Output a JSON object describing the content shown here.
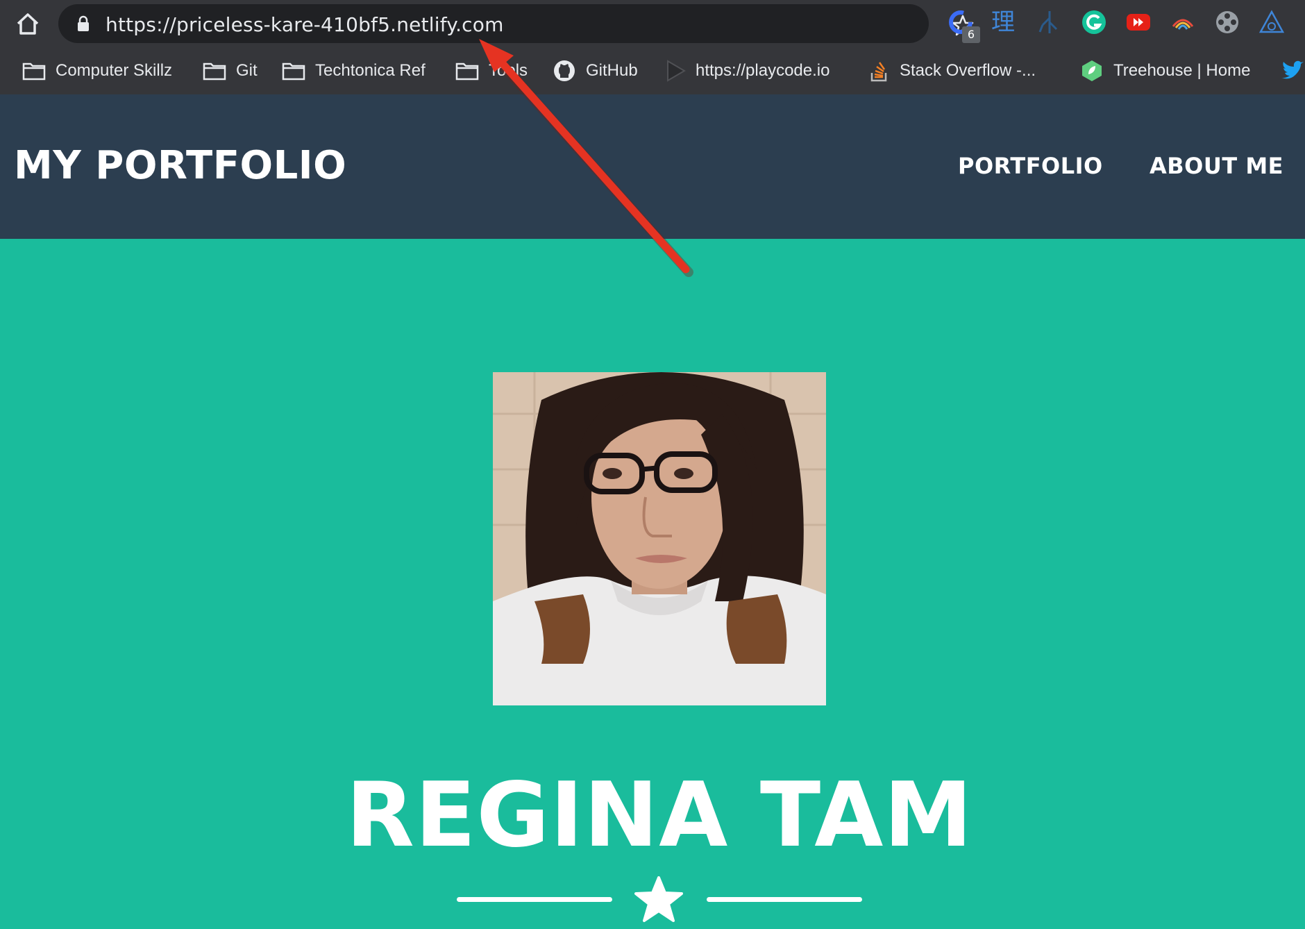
{
  "browser": {
    "url": "https://priceless-kare-410bf5.netlify.com",
    "extension_badge": "6",
    "extension_glyph": "理",
    "extensions": [
      "sync-icon",
      "dictionary-icon",
      "tree-icon",
      "grammarly-icon",
      "youtube-icon",
      "rainbow-icon",
      "film-reel-icon",
      "triangle-icon"
    ],
    "bookmarks": [
      {
        "label": "Computer Skillz",
        "icon": "folder-icon"
      },
      {
        "label": "Git",
        "icon": "folder-icon"
      },
      {
        "label": "Techtonica Ref",
        "icon": "folder-icon"
      },
      {
        "label": "Tools",
        "icon": "folder-icon"
      },
      {
        "label": "GitHub",
        "icon": "github-icon"
      },
      {
        "label": "https://playcode.io",
        "icon": "playcode-icon"
      },
      {
        "label": "Stack Overflow -...",
        "icon": "stackoverflow-icon"
      },
      {
        "label": "Treehouse | Home",
        "icon": "treehouse-icon"
      }
    ]
  },
  "site": {
    "brand": "MY PORTFOLIO",
    "nav": [
      {
        "label": "PORTFOLIO"
      },
      {
        "label": "ABOUT ME"
      }
    ],
    "masthead": {
      "name": "REGINA TAM",
      "divider_icon": "star-icon"
    }
  },
  "colors": {
    "chrome_bg": "#35363a",
    "omnibox_bg": "#202124",
    "navbar_bg": "#2c3e50",
    "masthead_bg": "#1abc9c",
    "annotation_arrow": "#e53322"
  }
}
